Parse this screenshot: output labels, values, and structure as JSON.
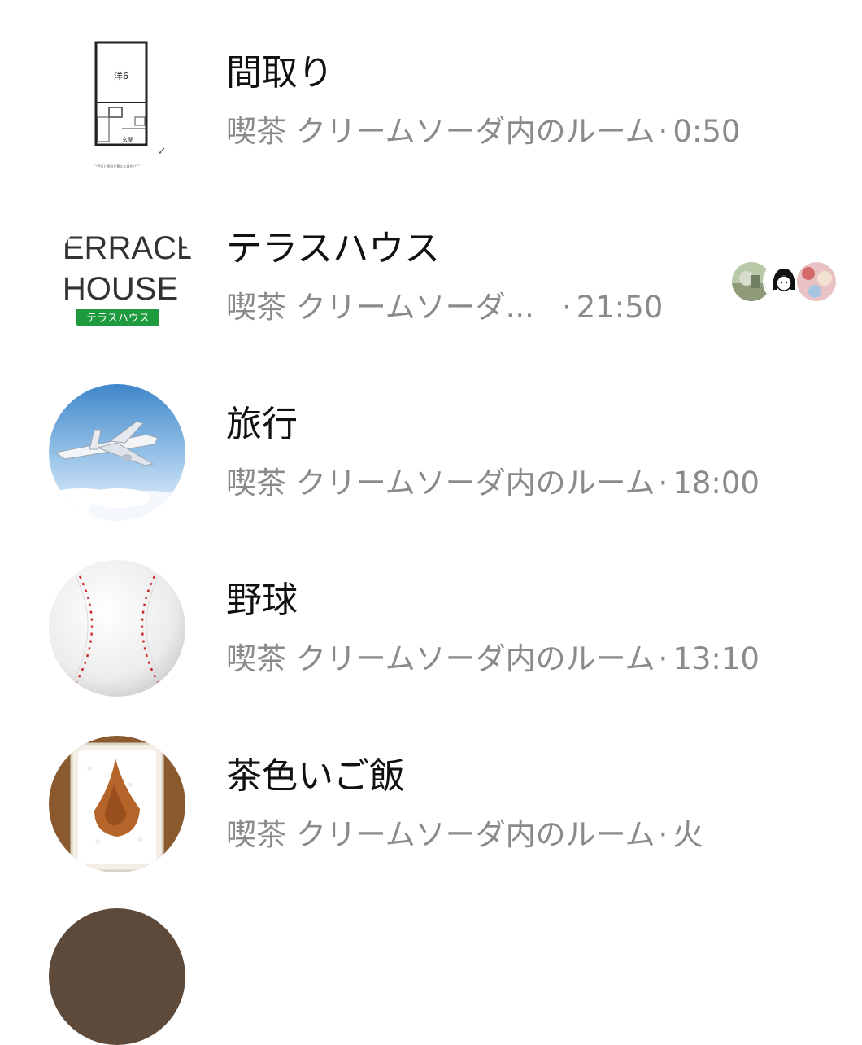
{
  "chats": [
    {
      "title": "間取り",
      "room": "喫茶 クリームソーダ内のルーム",
      "separator": "·",
      "time": "0:50",
      "avatar": "floor-plan"
    },
    {
      "title": "テラスハウス",
      "room": "喫茶 クリームソーダ...",
      "separator": "·",
      "time": "21:50",
      "avatar": "terrace-house-logo",
      "logo": {
        "line1": "TERRACE",
        "line2": "HOUSE",
        "band": "テラスハウス"
      }
    },
    {
      "title": "旅行",
      "room": "喫茶 クリームソーダ内のルーム",
      "separator": "·",
      "time": "18:00",
      "avatar": "airplane"
    },
    {
      "title": "野球",
      "room": "喫茶 クリームソーダ内のルーム",
      "separator": "·",
      "time": "13:10",
      "avatar": "baseball"
    },
    {
      "title": "茶色いご飯",
      "room": "喫茶 クリームソーダ内のルーム",
      "separator": "·",
      "time": "火",
      "avatar": "brown-rice"
    }
  ],
  "floor_plan_labels": {
    "room": "洋6",
    "entrance": "玄関",
    "note": "※図面と現況が異なる場合は現況を優先します。"
  },
  "colors": {
    "title": "#111111",
    "subtitle": "#8a8a8a",
    "logo_green": "#1f9a3f"
  }
}
